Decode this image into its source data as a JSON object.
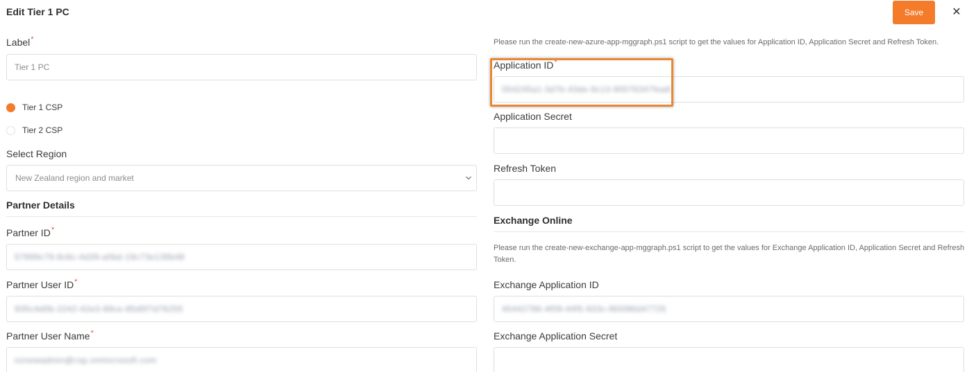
{
  "header": {
    "title": "Edit Tier 1 PC",
    "save_label": "Save",
    "close_glyph": "✕"
  },
  "colors": {
    "accent": "#f47b2a",
    "required": "#e0583f",
    "highlight": "#e8872f"
  },
  "left": {
    "label_title": "Label",
    "label_value": "Tier 1 PC",
    "radios": [
      {
        "label": "Tier 1 CSP",
        "selected": true
      },
      {
        "label": "Tier 2 CSP",
        "selected": false
      }
    ],
    "region_title": "Select Region",
    "region_value": "New Zealand region and market",
    "partner_section": "Partner Details",
    "partner_id_label": "Partner ID",
    "partner_id_value": "57899c79-8c6c-4d39-a0bd-19c73e139b48",
    "partner_user_id_label": "Partner User ID",
    "partner_user_id_value": "935c4d0b-2242-42e3-89ce-85d0f7d76255",
    "partner_user_name_label": "Partner User Name",
    "partner_user_name_value": "nznewadmin@csp.onmicrosoft.com"
  },
  "right": {
    "hint_1": "Please run the create-new-azure-app-mggraph.ps1 script to get the values for Application ID, Application Secret and Refresh Token.",
    "app_id_label": "Application ID",
    "app_id_value": "054245a1-3d7b-43de-9c13-90076347fea6",
    "app_secret_label": "Application Secret",
    "refresh_token_label": "Refresh Token",
    "exchange_section": "Exchange Online",
    "hint_2": "Please run the create-new-exchange-app-mggraph.ps1 script to get the values for Exchange Application ID, Application Secret and Refresh Token.",
    "ex_app_id_label": "Exchange Application ID",
    "ex_app_id_value": "45442786-4f09-44f5-933c-f60086d47725",
    "ex_app_secret_label": "Exchange Application Secret"
  },
  "required_mark": "*",
  "icons": {
    "chevron": "chevron-down-icon",
    "close": "close-icon"
  }
}
